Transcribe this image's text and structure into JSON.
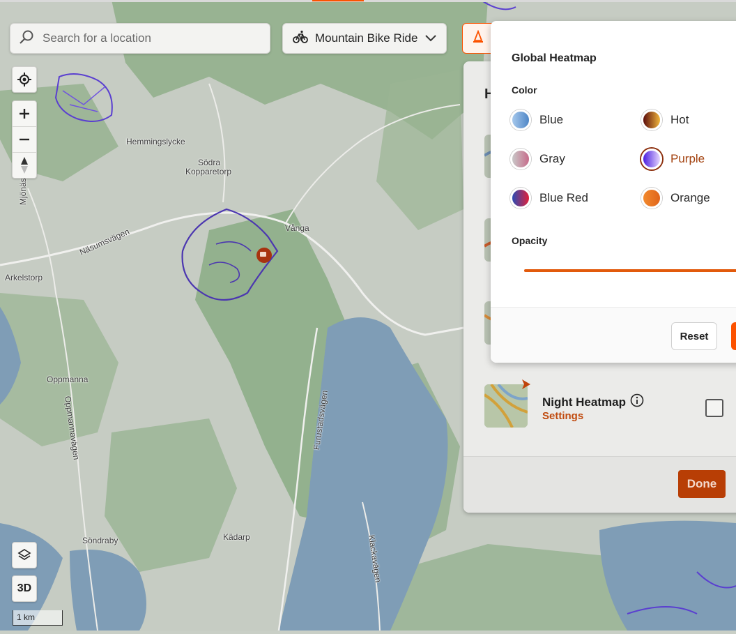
{
  "search": {
    "placeholder": "Search for a location"
  },
  "sport": {
    "label": "Mountain Bike Ride"
  },
  "map_controls": {
    "three_d_label": "3D",
    "scale_label": "1 km"
  },
  "map_labels": [
    {
      "text": "Hemmingslycke"
    },
    {
      "text": "Södra"
    },
    {
      "text": "Kopparetorp"
    },
    {
      "text": "Vånga"
    },
    {
      "text": "Näsumsvägen"
    },
    {
      "text": "Arkelstorp"
    },
    {
      "text": "Mjönäs"
    },
    {
      "text": "Oppmanna"
    },
    {
      "text": "Oppmannavägen"
    },
    {
      "text": "Furustadsvägen"
    },
    {
      "text": "Söndraby"
    },
    {
      "text": "Kädarp"
    },
    {
      "text": "Klackavägen"
    }
  ],
  "panel": {
    "header_letter": "H",
    "night_heatmap": {
      "title": "Night Heatmap",
      "settings_label": "Settings"
    },
    "done_label": "Done"
  },
  "popover": {
    "title": "Global Heatmap",
    "color_label": "Color",
    "opacity_label": "Opacity",
    "selected_color": "Purple",
    "colors": [
      {
        "name": "Blue",
        "gradient": [
          "#a6c8ec",
          "#4f86c6"
        ]
      },
      {
        "name": "Hot",
        "gradient": [
          "#5a0b0b",
          "#f0b63c"
        ]
      },
      {
        "name": "Gray",
        "gradient": [
          "#c8c8c8",
          "#c76b8a"
        ]
      },
      {
        "name": "Purple",
        "gradient": [
          "#4b1fe0",
          "#e6d6ff"
        ]
      },
      {
        "name": "Blue Red",
        "gradient": [
          "#2b4bb4",
          "#e0203a"
        ]
      },
      {
        "name": "Orange",
        "gradient": [
          "#f28a2e",
          "#e0641a"
        ]
      }
    ],
    "reset_label": "Reset"
  },
  "colors": {
    "accent": "#fc5200",
    "link": "#c04a0e",
    "done_bg": "#b83e05"
  }
}
